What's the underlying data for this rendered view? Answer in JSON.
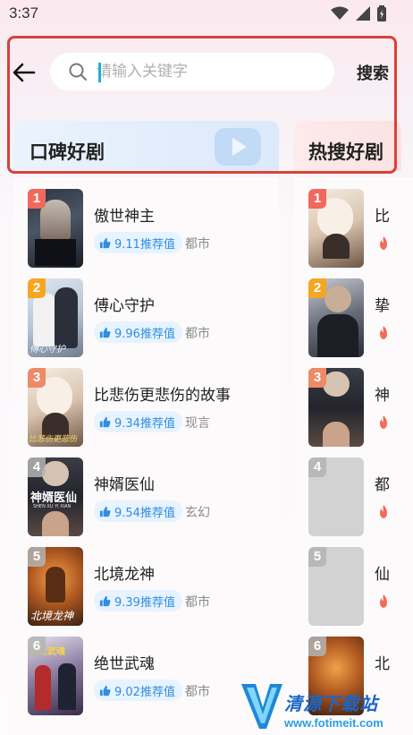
{
  "status": {
    "time": "3:37"
  },
  "header": {
    "search_placeholder": "请输入关键字",
    "search_button": "搜索"
  },
  "categories": {
    "left_title": "口碑好剧",
    "right_title": "热搜好剧"
  },
  "koubei_list": [
    {
      "rank": "1",
      "title": "傲世神主",
      "rating": "9.11推荐值",
      "genre": "都市"
    },
    {
      "rank": "2",
      "title": "傅心守护",
      "rating": "9.96推荐值",
      "genre": "都市"
    },
    {
      "rank": "3",
      "title": "比悲伤更悲伤的故事",
      "rating": "9.34推荐值",
      "genre": "现言"
    },
    {
      "rank": "4",
      "title": "神婿医仙",
      "rating": "9.54推荐值",
      "genre": "玄幻"
    },
    {
      "rank": "5",
      "title": "北境龙神",
      "rating": "9.39推荐值",
      "genre": "都市"
    },
    {
      "rank": "6",
      "title": "绝世武魂",
      "rating": "9.02推荐值",
      "genre": "都市"
    }
  ],
  "resou_list": [
    {
      "rank": "1",
      "title": "比"
    },
    {
      "rank": "2",
      "title": "挚"
    },
    {
      "rank": "3",
      "title": "神"
    },
    {
      "rank": "4",
      "title": "都"
    },
    {
      "rank": "5",
      "title": "仙"
    },
    {
      "rank": "6",
      "title": "北"
    }
  ],
  "poster_texts": {
    "p2": "傅心守护",
    "p3": "比悲伤更悲伤",
    "p4": "神婿医仙",
    "p4_sub": "SHEN XU YI XIAN",
    "p5": "北境龙神",
    "p6": "绝世武魂"
  },
  "watermark": {
    "title": "清源下载站",
    "url": "www.fotimeit.com"
  },
  "colors": {
    "highlight": "#d9413a",
    "accent_cyan": "#1cb2c7",
    "rating_blue": "#2f8de4",
    "fire": "#f26b5b"
  }
}
